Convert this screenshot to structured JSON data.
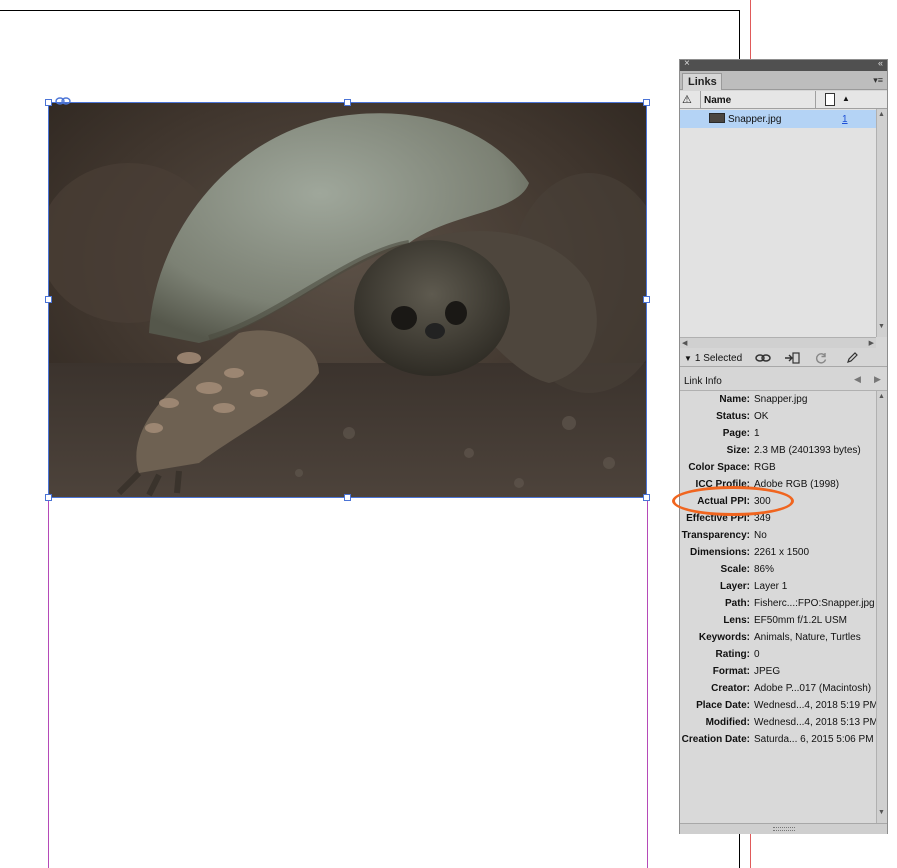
{
  "colors": {
    "selection": "#b4d3f5",
    "frame": "#4b74d6",
    "margin": "#b54ab8",
    "bleed": "#e05a5a",
    "highlight": "#f0651f",
    "page_link": "#1d4fd6"
  },
  "document": {
    "image_description_icon": "turtle-photo"
  },
  "panel": {
    "close_glyph": "×",
    "collapse_glyph": "«",
    "tab_label": "Links",
    "menu_glyph": "▾≡",
    "column_name": "Name",
    "warning_glyph": "⚠",
    "sort_glyph": "▲",
    "link": {
      "name": "Snapper.jpg",
      "page": "1"
    },
    "selection_text": "1 Selected",
    "selection_glyph": "▼",
    "info_title": "Link Info",
    "prev_glyph": "◀",
    "next_glyph": "▶",
    "info": [
      {
        "label": "Name:",
        "value": "Snapper.jpg"
      },
      {
        "label": "Status:",
        "value": "OK"
      },
      {
        "label": "Page:",
        "value": "1"
      },
      {
        "label": "Size:",
        "value": "2.3 MB (2401393 bytes)"
      },
      {
        "label": "Color Space:",
        "value": "RGB"
      },
      {
        "label": "ICC Profile:",
        "value": "Adobe RGB (1998)"
      },
      {
        "label": "Actual PPI:",
        "value": "300"
      },
      {
        "label": "Effective PPI:",
        "value": "349"
      },
      {
        "label": "Transparency:",
        "value": "No"
      },
      {
        "label": "Dimensions:",
        "value": "2261 x 1500"
      },
      {
        "label": "Scale:",
        "value": "86%"
      },
      {
        "label": "Layer:",
        "value": "Layer 1"
      },
      {
        "label": "Path:",
        "value": "Fisherc...:FPO:Snapper.jpg"
      },
      {
        "label": "Lens:",
        "value": "EF50mm f/1.2L USM"
      },
      {
        "label": "Keywords:",
        "value": "Animals, Nature, Turtles"
      },
      {
        "label": "Rating:",
        "value": "0"
      },
      {
        "label": "Format:",
        "value": "JPEG"
      },
      {
        "label": "Creator:",
        "value": "Adobe P...017 (Macintosh)"
      },
      {
        "label": "Place Date:",
        "value": "Wednesd...4, 2018 5:19 PM"
      },
      {
        "label": "Modified:",
        "value": "Wednesd...4, 2018 5:13 PM"
      },
      {
        "label": "Creation Date:",
        "value": "Saturda... 6, 2015 5:06 PM"
      }
    ]
  }
}
